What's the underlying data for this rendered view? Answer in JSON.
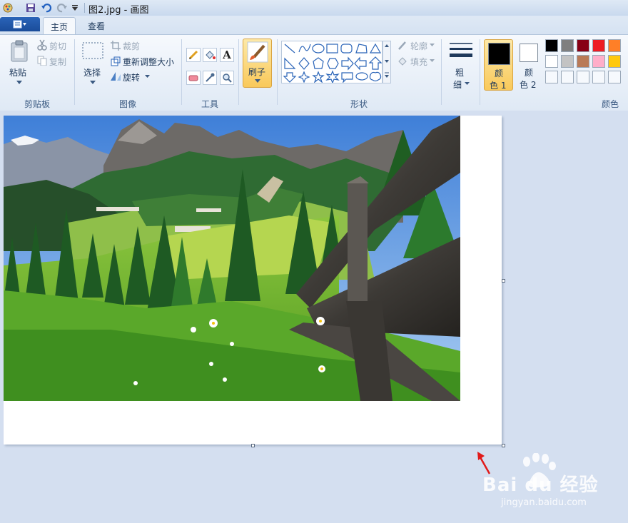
{
  "window": {
    "title": "图2.jpg - 画图"
  },
  "tabs": [
    {
      "label": "主页",
      "active": true
    },
    {
      "label": "查看",
      "active": false
    }
  ],
  "clipboard": {
    "paste": "粘贴",
    "cut": "剪切",
    "copy": "复制",
    "group": "剪贴板"
  },
  "image": {
    "select": "选择",
    "crop": "裁剪",
    "resize": "重新调整大小",
    "rotate": "旋转",
    "group": "图像"
  },
  "tools": {
    "group": "工具"
  },
  "brushes": {
    "label": "刷子"
  },
  "shapes": {
    "outline": "轮廓",
    "fill": "填充",
    "group": "形状"
  },
  "size": {
    "label1": "粗",
    "label2": "细"
  },
  "colors": {
    "color1_a": "颜",
    "color1_b": "色 1",
    "color2_a": "颜",
    "color2_b": "色 2",
    "group": "颜色",
    "color1": "#000000",
    "color2": "#ffffff",
    "palette_row1": [
      "#000000",
      "#7f7f7f",
      "#880015",
      "#ed1c24",
      "#ff7f27",
      "#fff200"
    ],
    "palette_row2": [
      "#ffffff",
      "#c3c3c3",
      "#b97a57",
      "#ffaec9",
      "#ffc90e",
      "#efe4b0"
    ]
  },
  "watermark": {
    "brand": "Bai du 经验",
    "url": "jingyan.baidu.com"
  }
}
